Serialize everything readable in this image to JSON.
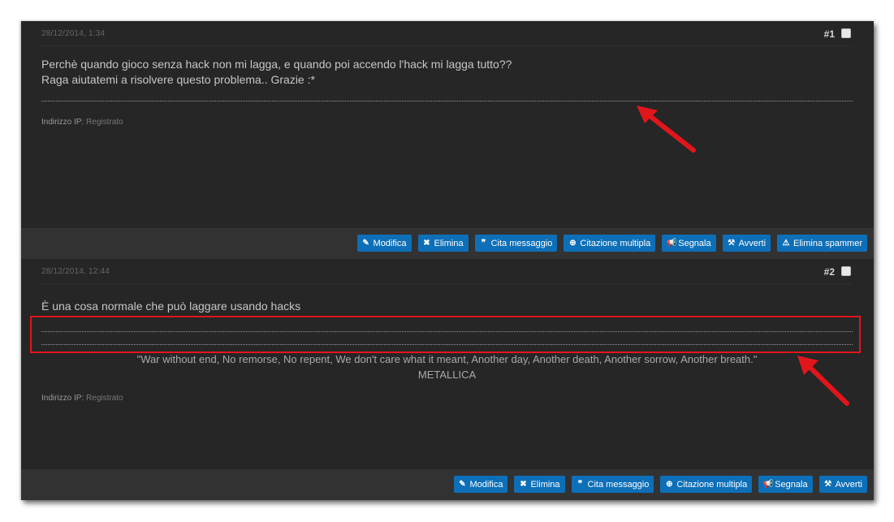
{
  "post1": {
    "date": "28/12/2014, 1:34",
    "number": "#1",
    "body_lines": [
      "Perchè quando gioco senza hack non mi lagga, e quando poi accendo l'hack mi lagga tutto??",
      "Raga aiutatemi a risolvere questo problema.. Grazie :*"
    ],
    "ip_label": "Indirizzo IP:",
    "ip_value": "Registrato",
    "buttons": [
      "Modifica",
      "Elimina",
      "Cita messaggio",
      "Citazione multipla",
      "Segnala",
      "Avverti",
      "Elimina spammer"
    ]
  },
  "post2": {
    "date": "28/12/2014, 12:44",
    "number": "#2",
    "body_lines": [
      "È una cosa normale che può laggare usando hacks"
    ],
    "signature_quote": "\"War without end, No remorse, No repent, We don't care what it meant, Another day, Another death, Another sorrow, Another breath.\"",
    "signature_author": "METALLICA",
    "ip_label": "Indirizzo IP:",
    "ip_value": "Registrato",
    "buttons": [
      "Modifica",
      "Elimina",
      "Cita messaggio",
      "Citazione multipla",
      "Segnala",
      "Avverti"
    ]
  },
  "icons": {
    "Modifica": "edit-icon",
    "Elimina": "close-icon",
    "Cita messaggio": "quote-icon",
    "Citazione multipla": "plus-circle-icon",
    "Segnala": "megaphone-icon",
    "Avverti": "gavel-icon",
    "Elimina spammer": "warning-icon"
  },
  "colors": {
    "background": "#262626",
    "toolbar": "#323232",
    "button": "#0d6fb8",
    "annotation": "#e0161b"
  }
}
